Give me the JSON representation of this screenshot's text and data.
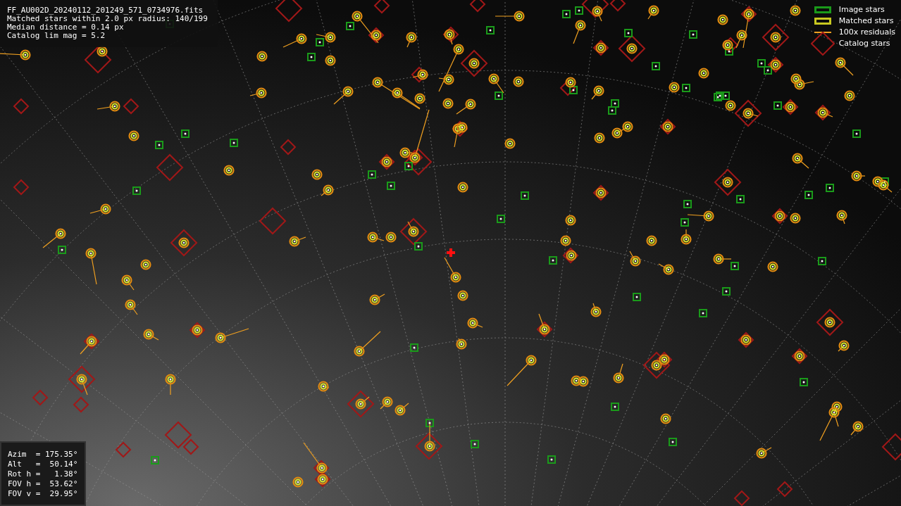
{
  "info": {
    "lines": [
      "FF_AU002D_20240112_201249_571_0734976.fits",
      "Matched stars within 2.0 px radius: 140/199",
      "Median distance = 0.14 px",
      "Catalog lim mag = 5.2"
    ]
  },
  "legend": [
    {
      "kind": "image",
      "label": "Image stars"
    },
    {
      "kind": "matched",
      "label": "Matched stars"
    },
    {
      "kind": "residual",
      "label": "100x residuals"
    },
    {
      "kind": "catalog",
      "label": "Catalog stars"
    }
  ],
  "pointing": {
    "lines": [
      "Azim  = 175.35°",
      "Alt   =  50.14°",
      "Rot h =   1.38°",
      "FOV h =  53.62°",
      "FOV v =  29.95°"
    ]
  }
}
